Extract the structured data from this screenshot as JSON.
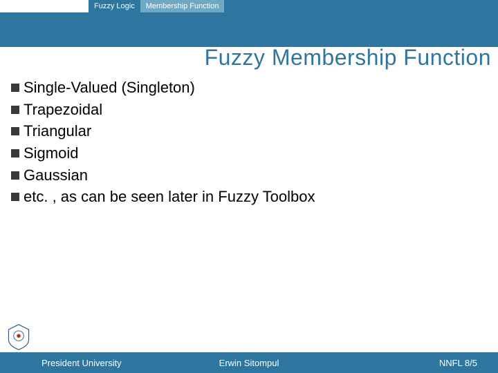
{
  "breadcrumb": {
    "item1": "Fuzzy Logic",
    "item2": "Membership Function"
  },
  "title": "Fuzzy Membership Function",
  "bullets": [
    "Single-Valued (Singleton)",
    "Trapezoidal",
    "Triangular",
    "Sigmoid",
    "Gaussian",
    "etc. , as can be seen later in Fuzzy Toolbox"
  ],
  "footer": {
    "left": "President University",
    "center": "Erwin Sitompul",
    "right": "NNFL 8/5"
  }
}
